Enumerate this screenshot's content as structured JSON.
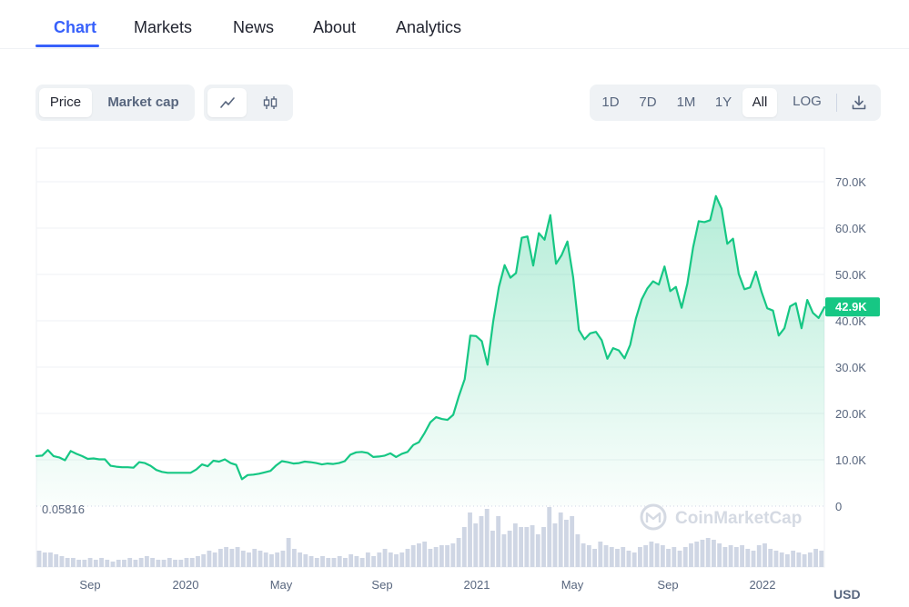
{
  "nav": {
    "tabs": [
      "Chart",
      "Markets",
      "News",
      "About",
      "Analytics"
    ],
    "active": "Chart"
  },
  "toolbar": {
    "view_toggle": [
      "Price",
      "Market cap"
    ],
    "view_selected": "Price",
    "chart_style_icons": [
      "line-chart-icon",
      "candlestick-icon"
    ],
    "ranges": [
      "1D",
      "7D",
      "1M",
      "1Y",
      "All"
    ],
    "range_selected": "All",
    "log_label": "LOG",
    "download_icon": "download-icon"
  },
  "chart_data": {
    "type": "area",
    "x_tick_labels": [
      "Sep",
      "2020",
      "May",
      "Sep",
      "2021",
      "May",
      "Sep",
      "2022"
    ],
    "y_tick_labels": [
      "70.0K",
      "60.0K",
      "50.0K",
      "40.0K",
      "30.0K",
      "20.0K",
      "10.0K",
      "0"
    ],
    "ylim": [
      0,
      70000
    ],
    "current_price_label": "42.9K",
    "min_label": "0.05816",
    "currency_label": "USD",
    "watermark": "CoinMarketCap",
    "line_color": "#16c784",
    "series": [
      {
        "values": [
          10800,
          10900,
          12100,
          10800,
          10500,
          9900,
          11900,
          11300,
          10800,
          10200,
          10300,
          10100,
          10100,
          8700,
          8500,
          8400,
          8400,
          8300,
          9500,
          9300,
          8700,
          7800,
          7400,
          7200,
          7200,
          7200,
          7200,
          7200,
          7900,
          9000,
          8600,
          9800,
          9600,
          10100,
          9300,
          8900,
          5800,
          6700,
          6800,
          7000,
          7300,
          7600,
          8800,
          9700,
          9500,
          9200,
          9300,
          9600,
          9500,
          9300,
          9000,
          9200,
          9100,
          9300,
          9700,
          11100,
          11600,
          11700,
          11500,
          10600,
          10700,
          10900,
          11400,
          10600,
          11300,
          11700,
          13200,
          13800,
          15800,
          18100,
          19200,
          18800,
          18600,
          19700,
          23800,
          27400,
          36800,
          36700,
          35600,
          30500,
          39800,
          47300,
          52000,
          49300,
          50300,
          57900,
          58200,
          51900,
          58900,
          57500,
          62800,
          52300,
          54200,
          57100,
          49400,
          38000,
          36000,
          37300,
          37600,
          35800,
          31800,
          34100,
          33600,
          31900,
          34800,
          40500,
          44600,
          47000,
          48500,
          47800,
          51700,
          46400,
          47300,
          42800,
          48000,
          55800,
          61500,
          61300,
          61700,
          66900,
          64200,
          56600,
          57700,
          50100,
          46800,
          47200,
          50600,
          46200,
          42700,
          42200,
          36800,
          38400,
          43100,
          43800,
          38400,
          44500,
          41700,
          40600,
          42900
        ]
      }
    ],
    "volume": [
      9,
      8,
      8,
      7,
      6,
      5,
      5,
      4,
      4,
      5,
      4,
      5,
      4,
      3,
      4,
      4,
      5,
      4,
      5,
      6,
      5,
      4,
      4,
      5,
      4,
      4,
      5,
      5,
      6,
      7,
      9,
      8,
      10,
      11,
      10,
      11,
      9,
      8,
      10,
      9,
      8,
      7,
      8,
      9,
      16,
      10,
      8,
      7,
      6,
      5,
      6,
      5,
      5,
      6,
      5,
      7,
      6,
      5,
      8,
      6,
      8,
      10,
      8,
      7,
      8,
      10,
      12,
      13,
      14,
      10,
      11,
      12,
      12,
      13,
      16,
      22,
      30,
      24,
      28,
      32,
      20,
      28,
      18,
      20,
      24,
      22,
      22,
      23,
      18,
      22,
      33,
      24,
      30,
      26,
      28,
      18,
      13,
      12,
      10,
      14,
      12,
      11,
      10,
      11,
      9,
      8,
      11,
      12,
      14,
      13,
      12,
      10,
      11,
      9,
      11,
      13,
      14,
      15,
      16,
      15,
      13,
      11,
      12,
      11,
      12,
      10,
      9,
      12,
      13,
      10,
      9,
      8,
      7,
      9,
      8,
      7,
      8,
      10,
      9
    ]
  }
}
